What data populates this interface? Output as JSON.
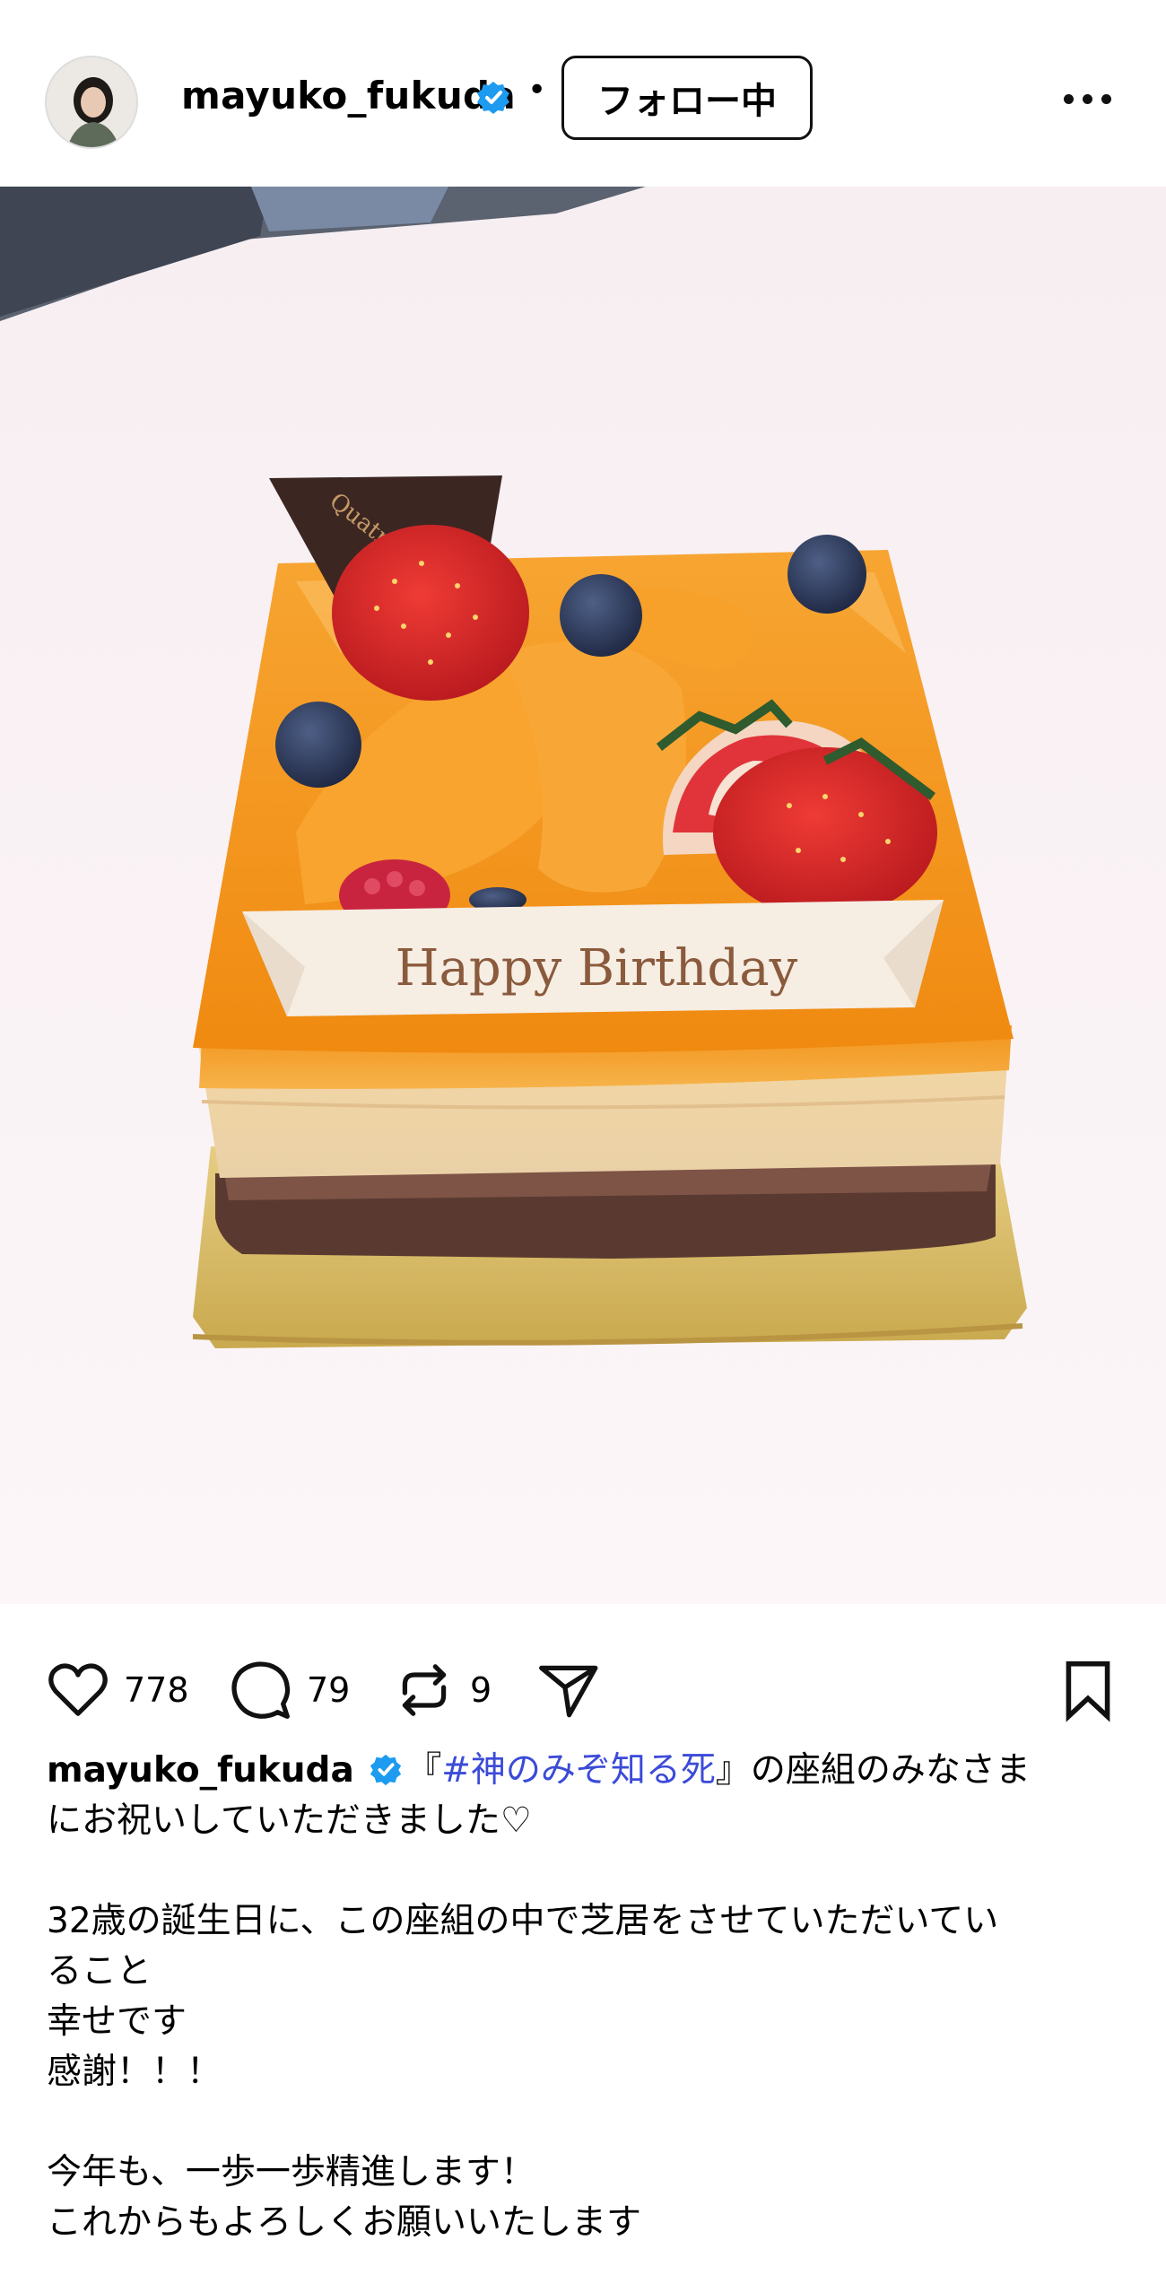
{
  "header": {
    "username": "mayuko_fukuda",
    "separator": "•",
    "follow_label": "フォロー中"
  },
  "photo": {
    "plaque_text": "Happy Birthday",
    "chocolate_text": "Quatre"
  },
  "actions": {
    "likes": "778",
    "comments": "79",
    "reposts": "9"
  },
  "caption": {
    "username": "mayuko_fukuda",
    "line1_pre": "『",
    "hashtag": "#神のみぞ知る死",
    "line1_post": "』の座組のみなさま",
    "line2": "にお祝いしていただきました♡",
    "line3": "32歳の誕生日に、この座組の中で芝居をさせていただいてい",
    "line4": "ること",
    "line5": "幸せです",
    "line6": "感謝！！！",
    "line7": "今年も、一歩一歩精進します！",
    "line8": "これからもよろしくお願いいたします"
  },
  "colors": {
    "verified_blue": "#1d9bf0",
    "hashtag_blue": "#3b4bd8",
    "photo_background": "#fbf2f4",
    "glaze_orange": "#f59a1c"
  },
  "icons": [
    "verified-badge-icon",
    "more-options-icon",
    "heart-icon",
    "comment-icon",
    "repost-icon",
    "share-icon",
    "bookmark-icon"
  ]
}
